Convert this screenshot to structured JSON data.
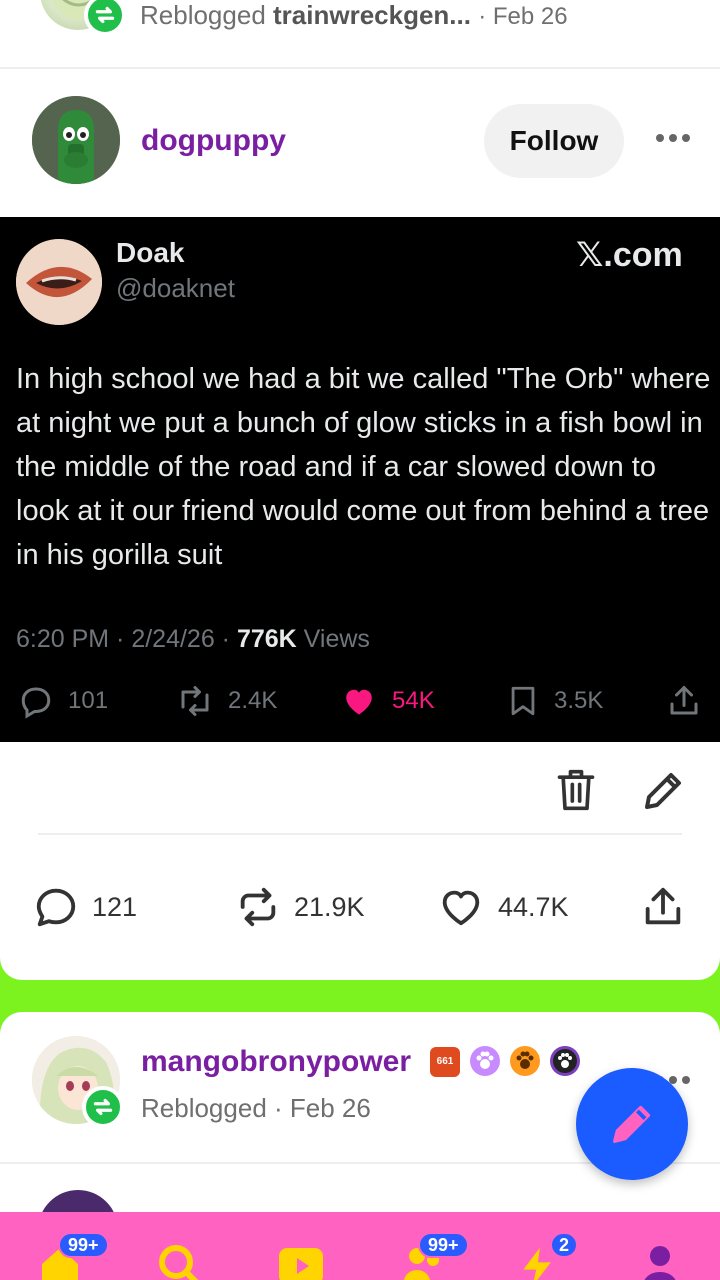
{
  "previous_post": {
    "reblogged_prefix": "Reblogged",
    "reblogged_from": "trainwreckgen...",
    "date": "· Feb 26"
  },
  "post": {
    "username": "dogpuppy",
    "follow_label": "Follow",
    "embedded_tweet": {
      "display_name": "Doak",
      "handle": "@doaknet",
      "brand": "𝕏.com",
      "text": "In high school we had a bit we called \"The Orb\" where at night we put a bunch of glow sticks in a fish bowl in the middle of the road and if a car slowed down to look at it our friend would come out from behind a tree in his gorilla suit",
      "timestamp": "6:20 PM · 2/24/26 · ",
      "views_count": "776K",
      "views_label": " Views",
      "replies": "101",
      "reposts": "2.4K",
      "likes": "54K",
      "bookmarks": "3.5K"
    },
    "actions": {
      "replies": "121",
      "reblogs": "21.9K",
      "likes": "44.7K"
    }
  },
  "next_post": {
    "username": "mangobronypower",
    "reblog_text": "Reblogged · Feb 26",
    "badge_text": "661"
  },
  "bottom_nav": {
    "home_badge": "99+",
    "activity_badge": "99+",
    "notifications_badge": "2"
  },
  "colors": {
    "page_background": "#7cf21e",
    "username": "#7a1fa2",
    "nav_background": "#ff62c0",
    "fab": "#1a5cff",
    "tweet_like": "#f91880"
  }
}
